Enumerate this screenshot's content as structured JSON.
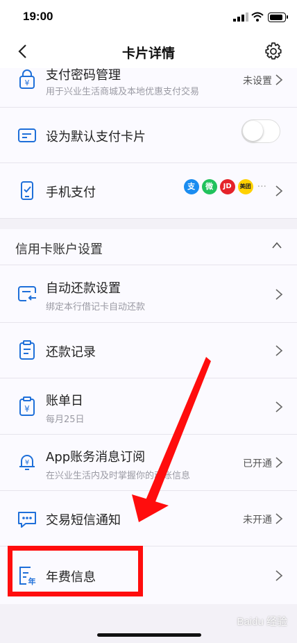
{
  "status": {
    "time": "19:00"
  },
  "nav": {
    "title": "卡片详情"
  },
  "rows": [
    {
      "label": "支付密码管理",
      "sub": "用于兴业生活商城及本地优惠支付交易",
      "right": "未设置"
    },
    {
      "label": "设为默认支付卡片",
      "toggle_on": false
    },
    {
      "label": "手机支付",
      "pay_icons": [
        "支",
        "微",
        "JD",
        "美团"
      ],
      "more": "···"
    }
  ],
  "section": {
    "title": "信用卡账户设置"
  },
  "account_rows": [
    {
      "label": "自动还款设置",
      "sub": "绑定本行借记卡自动还款"
    },
    {
      "label": "还款记录"
    },
    {
      "label": "账单日",
      "sub": "每月25日"
    },
    {
      "label": "App账务消息订阅",
      "sub": "在兴业生活内及时掌握你的动账信息",
      "right": "已开通"
    },
    {
      "label": "交易短信通知",
      "right": "未开通"
    },
    {
      "label": "年费信息"
    }
  ],
  "watermark": "Baidu 经验",
  "colors": {
    "accent": "#1e6fd9",
    "highlight": "#ff0d0d"
  }
}
